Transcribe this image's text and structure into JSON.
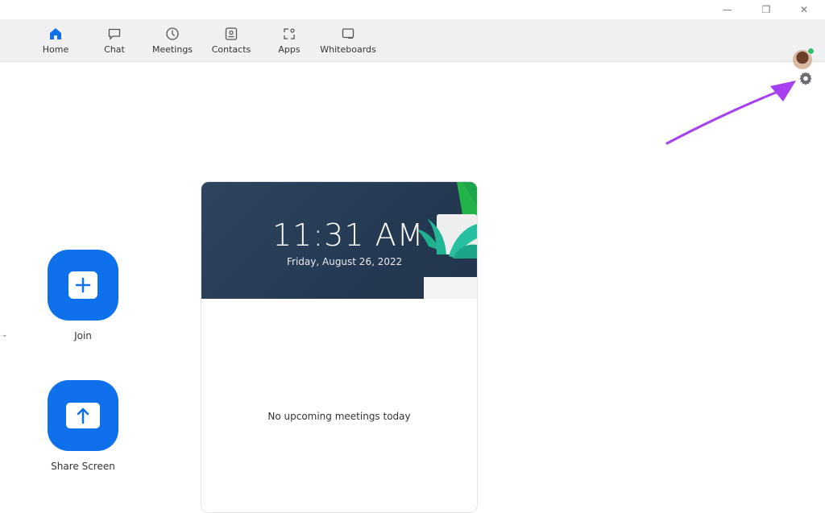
{
  "window": {
    "controls": {
      "minimize": "—",
      "restore": "❐",
      "close": "✕"
    }
  },
  "nav": {
    "items": [
      {
        "label": "Home",
        "icon": "home-icon",
        "active": true
      },
      {
        "label": "Chat",
        "icon": "chat-icon",
        "active": false
      },
      {
        "label": "Meetings",
        "icon": "clock-icon",
        "active": false
      },
      {
        "label": "Contacts",
        "icon": "contact-card-icon",
        "active": false
      },
      {
        "label": "Apps",
        "icon": "apps-icon",
        "active": false
      },
      {
        "label": "Whiteboards",
        "icon": "whiteboard-icon",
        "active": false
      }
    ],
    "active_color": "#0e71eb",
    "presence_status_color": "#2fc26b"
  },
  "settings": {
    "icon": "gear-icon",
    "annotation_arrow_color": "#a63ff0"
  },
  "actions": {
    "join": {
      "label": "Join",
      "icon": "plus-icon"
    },
    "share": {
      "label": "Share Screen",
      "icon": "upload-arrow-icon"
    },
    "expand_glyph": "⌄"
  },
  "clock_card": {
    "time": "11:31 AM",
    "date": "Friday, August 26, 2022",
    "empty_message": "No upcoming meetings today"
  }
}
